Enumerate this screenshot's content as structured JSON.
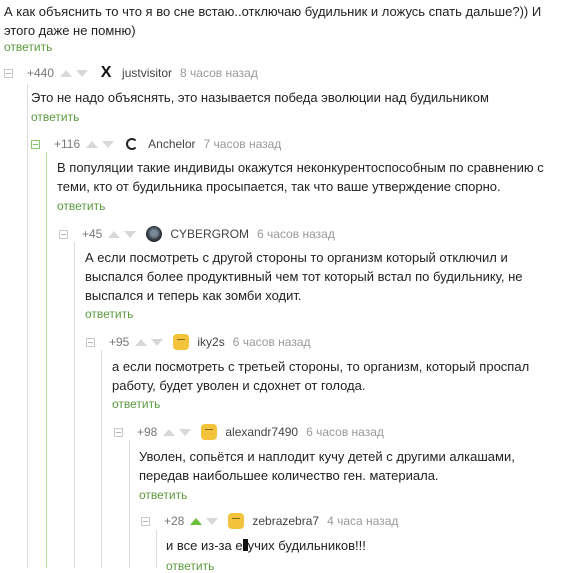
{
  "top": {
    "text": "А как объяснить то что я во сне встаю..отключаю будильник и ложусь спать дальше?)) И этого даже не помню)",
    "reply": "ответить"
  },
  "comments": [
    {
      "rating": "+440",
      "author": "justvisitor",
      "time": "8 часов назад",
      "avatar": "x-logo-icon",
      "text": "Это не надо объяснять, это называется победа эволюции над будильником",
      "reply": "ответить"
    },
    {
      "rating": "+116",
      "author": "Anchelor",
      "time": "7 часов назад",
      "avatar": "ring-logo-icon",
      "text": "В популяции такие индивиды окажутся неконкурентоспособным по сравнению с теми, кто от будильника просыпается, так что ваше утверждение спорно.",
      "reply": "ответить"
    },
    {
      "rating": "+45",
      "author": "CYBERGROM",
      "time": "6 часов назад",
      "avatar": "dark-avatar-icon",
      "text": "А если посмотреть с другой стороны то организм который отключил и выспался более продуктивный чем тот который встал по будильнику, не выспался и теперь как зомби ходит.",
      "reply": "ответить"
    },
    {
      "rating": "+95",
      "author": "iky2s",
      "time": "6 часов назад",
      "avatar": "yellow-face-icon",
      "text": "а если посмотреть с третьей стороны, то организм, который проспал работу, будет уволен и сдохнет от голода.",
      "reply": "ответить"
    },
    {
      "rating": "+98",
      "author": "alexandr7490",
      "time": "6 часов назад",
      "avatar": "yellow-face-icon",
      "text": "Уволен, сопьётся и наплодит кучу детей с другими алкашами, передав наибольшее количество ген. материала.",
      "reply": "ответить"
    },
    {
      "rating": "+28",
      "author": "zebrazebra7",
      "time": "4 часа назад",
      "avatar": "yellow-face-icon",
      "text_before": "и все из-за е",
      "text_after": "учих будильников!!!",
      "reply": "ответить"
    }
  ],
  "colors": {
    "reply_link": "#5a9a3c",
    "upvote_active": "#6abf3a",
    "thread_active": "#b8e09a"
  }
}
